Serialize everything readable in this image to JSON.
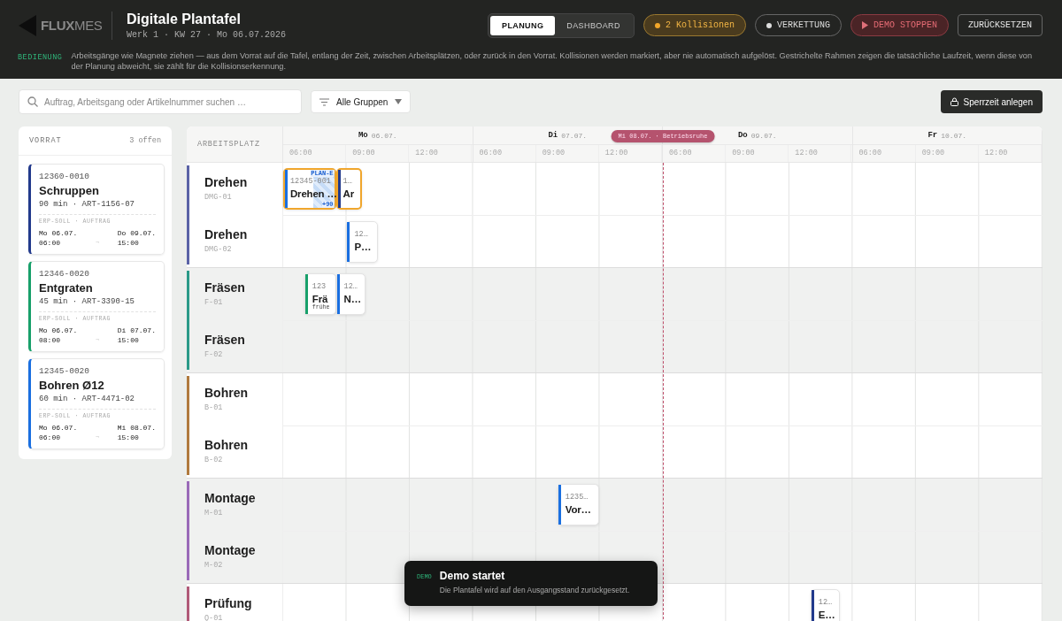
{
  "header": {
    "logo": "**FLUX**MES",
    "title": "Digitale Plantafel",
    "subtitle": "Werk 1 · KW 27 · Mo 06.07.2026",
    "view_tabs": [
      {
        "label": "PLANUNG",
        "selected": true
      },
      {
        "label": "DASHBOARD",
        "selected": false
      }
    ],
    "actions": [
      {
        "kind": "collisions",
        "label": "2 Kollisionen"
      },
      {
        "kind": "toggle",
        "label": "VERKETTUNG",
        "on": false
      },
      {
        "kind": "demo",
        "label": "DEMO STOPPEN"
      },
      {
        "kind": "plain",
        "label": "ZURÜCKSETZEN"
      }
    ],
    "hint": {
      "tag": "BEDIENUNG",
      "text": "Arbeitsgänge wie Magnete ziehen — aus dem Vorrat auf die Tafel, entlang der Zeit, zwischen Arbeitsplätzen, oder zurück in den Vorrat. Kollisionen werden markiert, aber nie automatisch aufgelöst. Gestrichelte Rahmen zeigen die tatsächliche Laufzeit, wenn diese von der Planung abweicht, sie zählt für die Kollisionserkennung."
    }
  },
  "toolbar": {
    "search": {
      "placeholder": "Auftrag, Arbeitsgang oder Artikelnummer suchen …"
    },
    "group_filter": "Alle Gruppen",
    "lock_button": "Sperrzeit anlegen"
  },
  "backlog": {
    "title": "VORRAT",
    "count": "3 offen",
    "cards": [
      {
        "order": "12360-0010",
        "name": "Schruppen",
        "spec": "90 min · ART-1156-07",
        "meta": "ERP-SOLL · AUFTRAG",
        "from_date": "Mo 06.07.",
        "from_time": "06:00",
        "arrow": "→",
        "to_date": "Do 09.07.",
        "to_time": "15:00",
        "color": "#223a8c"
      },
      {
        "order": "12346-0020",
        "name": "Entgraten",
        "spec": "45 min · ART-3390-15",
        "meta": "ERP-SOLL · AUFTRAG",
        "from_date": "Mo 06.07.",
        "from_time": "08:00",
        "arrow": "→",
        "to_date": "Di 07.07.",
        "to_time": "15:00",
        "color": "#18a06a"
      },
      {
        "order": "12345-0020",
        "name": "Bohren Ø12",
        "spec": "60 min · ART-4471-02",
        "meta": "ERP-SOLL · AUFTRAG",
        "from_date": "Mo 06.07.",
        "from_time": "06:00",
        "arrow": "→",
        "to_date": "Mi 08.07.",
        "to_time": "15:00",
        "color": "#1a6fe0"
      }
    ]
  },
  "board": {
    "column_header": "ARBEITSPLATZ",
    "days": [
      {
        "kind": "open",
        "name": "Mo",
        "date": "06.07.",
        "hours": [
          "06:00",
          "09:00",
          "12:00"
        ]
      },
      {
        "kind": "open",
        "name": "Di",
        "date": "07.07.",
        "hours": [
          "06:00",
          "09:00",
          "12:00"
        ]
      },
      {
        "kind": "closed",
        "label": "Mi 08.07. · Betriebsruhe"
      },
      {
        "kind": "open",
        "name": "Do",
        "date": "09.07.",
        "hours": [
          "06:00",
          "09:00",
          "12:00"
        ]
      },
      {
        "kind": "open",
        "name": "Fr",
        "date": "10.07.",
        "hours": [
          "06:00",
          "09:00",
          "12:00"
        ]
      }
    ],
    "groups": [
      {
        "color": "#5a62a6",
        "shaded": false,
        "rows": [
          {
            "name": "Drehen",
            "code": "DMG-01",
            "blocks": [
              {
                "order": "12345-001",
                "title": "Drehen …",
                "color": "#1a6fe0",
                "collision": true,
                "overrun": {
                  "label": "PLAN-E",
                  "extra": "+90"
                }
              },
              {
                "order": "1…",
                "title": "Ar",
                "color": "#223a8c",
                "collision": true
              }
            ]
          },
          {
            "name": "Drehen",
            "code": "DMG-02",
            "blocks": [
              {
                "order": "12…",
                "title": "P…",
                "color": "#1a6fe0",
                "collision": false
              }
            ]
          }
        ]
      },
      {
        "color": "#2a9a88",
        "shaded": true,
        "rows": [
          {
            "name": "Fräsen",
            "code": "F-01",
            "blocks": [
              {
                "order": "123",
                "title": "Frä",
                "note": "frühe",
                "color": "#18a06a",
                "collision": false
              },
              {
                "order": "12…",
                "title": "N…",
                "color": "#1a6fe0",
                "collision": false
              }
            ]
          },
          {
            "name": "Fräsen",
            "code": "F-02",
            "blocks": []
          }
        ]
      },
      {
        "color": "#b07a3e",
        "shaded": false,
        "rows": [
          {
            "name": "Bohren",
            "code": "B-01",
            "blocks": []
          },
          {
            "name": "Bohren",
            "code": "B-02",
            "blocks": []
          }
        ]
      },
      {
        "color": "#9a6ab8",
        "shaded": true,
        "rows": [
          {
            "name": "Montage",
            "code": "M-01",
            "blocks": [
              {
                "order": "1235…",
                "title": "Vor…",
                "color": "#1a6fe0",
                "collision": false
              }
            ]
          },
          {
            "name": "Montage",
            "code": "M-02",
            "blocks": []
          }
        ]
      },
      {
        "color": "#b05a78",
        "shaded": false,
        "rows": [
          {
            "name": "Prüfung",
            "code": "Q-01",
            "blocks": [
              {
                "order": "12…",
                "title": "E…",
                "color": "#223a8c",
                "collision": false
              }
            ]
          }
        ]
      }
    ]
  },
  "toast": {
    "tag": "DEMO",
    "title": "Demo startet",
    "text": "Die Plantafel wird auf den Ausgangsstand zurückgesetzt."
  }
}
